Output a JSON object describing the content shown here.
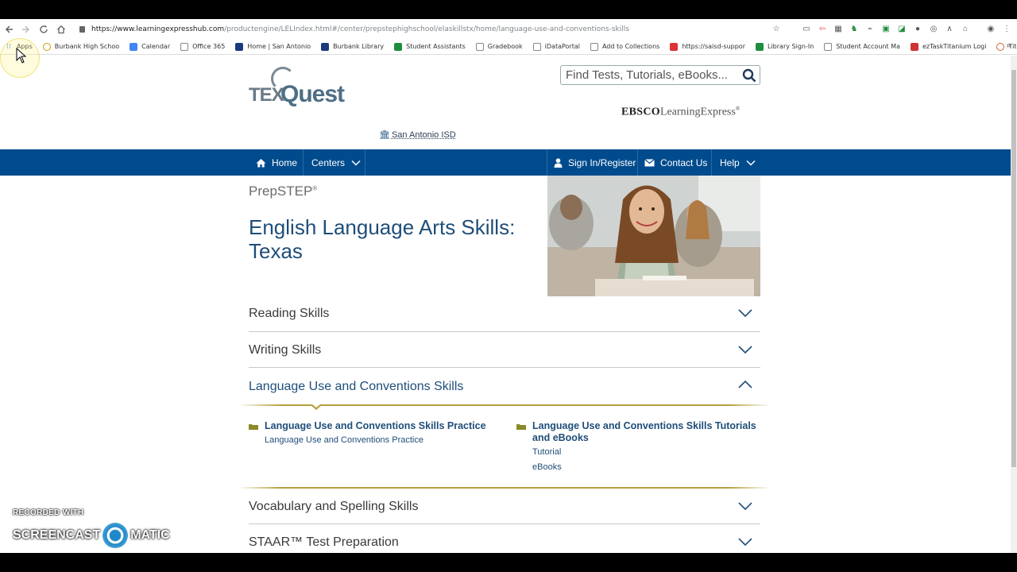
{
  "browser": {
    "url_host": "https://www.learningexpresshub.com",
    "url_path": "/productengine/LELIndex.html#/center/prepstephighschool/elaskillstx/home/language-use-and-conventions-skills",
    "bookmarks": [
      {
        "label": "Apps",
        "icon": "apps-icon"
      },
      {
        "label": "Burbank High Schoo",
        "icon": "site-icon"
      },
      {
        "label": "Calendar",
        "icon": "calendar-icon"
      },
      {
        "label": "Office 365",
        "icon": "page-icon"
      },
      {
        "label": "Home | San Antonio",
        "icon": "site-icon"
      },
      {
        "label": "Burbank Library",
        "icon": "site-icon"
      },
      {
        "label": "Student Assistants",
        "icon": "sheets-icon"
      },
      {
        "label": "Gradebook",
        "icon": "page-icon"
      },
      {
        "label": "iDataPortal",
        "icon": "page-icon"
      },
      {
        "label": "Add to Collections",
        "icon": "page-icon"
      },
      {
        "label": "https://saisd-suppor",
        "icon": "site-icon"
      },
      {
        "label": "Library Sign-In",
        "icon": "sheets-icon"
      },
      {
        "label": "Student Account Ma",
        "icon": "page-icon"
      },
      {
        "label": "ezTaskTitanium Logi",
        "icon": "site-icon"
      },
      {
        "label": "Titlewave",
        "icon": "site-icon"
      }
    ],
    "more": "»"
  },
  "header": {
    "logo_tex": "TEX",
    "logo_quest": "Quest",
    "district": "San Antonio ISD",
    "search_placeholder": "Find Tests, Tutorials, eBooks...",
    "ebsco_bold": "EBSCO",
    "ebsco_rest": "LearningExpress",
    "ebsco_reg": "®"
  },
  "nav": {
    "home": "Home",
    "centers": "Centers",
    "signin": "Sign In/Register",
    "contact": "Contact Us",
    "help": "Help"
  },
  "hero": {
    "brand": "PrepSTEP",
    "brand_reg": "®",
    "title": "English Language Arts Skills: Texas"
  },
  "sections": [
    {
      "label": "Reading Skills",
      "expanded": false
    },
    {
      "label": "Writing Skills",
      "expanded": false
    },
    {
      "label": "Language Use and Conventions Skills",
      "expanded": true
    },
    {
      "label": "Vocabulary and Spelling Skills",
      "expanded": false
    },
    {
      "label": "STAAR™ Test Preparation",
      "expanded": false
    }
  ],
  "panel": {
    "left_head": "Language Use and Conventions Skills Practice",
    "left_links": [
      "Language Use and Conventions Practice"
    ],
    "right_head_line1": "Language Use and Conventions Skills Tutorials",
    "right_head_line2": "and eBooks",
    "right_links": [
      "Tutorial",
      "eBooks"
    ]
  },
  "watermark": {
    "top": "RECORDED WITH",
    "left": "SCREENCAST",
    "right": "MATIC"
  },
  "colors": {
    "nav_bg": "#004b8d",
    "title": "#1f4e79",
    "accent_gold": "#b4a03c"
  }
}
